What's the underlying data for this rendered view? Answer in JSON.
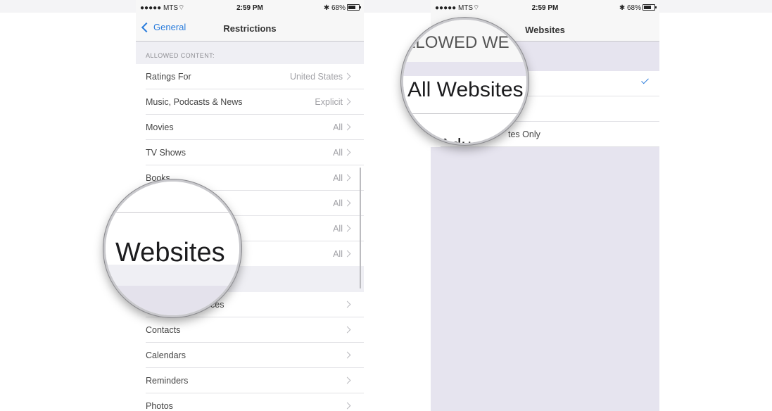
{
  "status_bar": {
    "carrier": "●●●●● MTS",
    "time": "2:59 PM",
    "battery": "68%",
    "icons": [
      "wifi-icon",
      "bluetooth-icon",
      "battery-icon"
    ]
  },
  "left_screen": {
    "back_label": "General",
    "title": "Restrictions",
    "section_header": "ALLOWED CONTENT:",
    "content_rows": [
      {
        "label": "Ratings For",
        "value": "United States"
      },
      {
        "label": "Music, Podcasts & News",
        "value": "Explicit"
      },
      {
        "label": "Movies",
        "value": "All"
      },
      {
        "label": "TV Shows",
        "value": "All"
      },
      {
        "label": "Books",
        "value": "All"
      },
      {
        "label": "",
        "value": "All"
      },
      {
        "label": "",
        "value": "All"
      },
      {
        "label": "",
        "value": "All"
      }
    ],
    "privacy_rows": [
      {
        "label": "ces"
      },
      {
        "label": "Contacts"
      },
      {
        "label": "Calendars"
      },
      {
        "label": "Reminders"
      },
      {
        "label": "Photos"
      }
    ],
    "magnifier_text": "Websites"
  },
  "right_screen": {
    "title": "Websites",
    "options": [
      {
        "label": "",
        "checked": true
      },
      {
        "label": "",
        "checked": false
      },
      {
        "label": "tes Only",
        "checked": false
      }
    ],
    "magnifier_header": "LLOWED WE",
    "magnifier_selected": "All Websites",
    "magnifier_bottom": "it Adu"
  },
  "colors": {
    "accent": "#2a7cdc",
    "background": "#efeff4",
    "secondary_text": "#a1a1a6"
  }
}
